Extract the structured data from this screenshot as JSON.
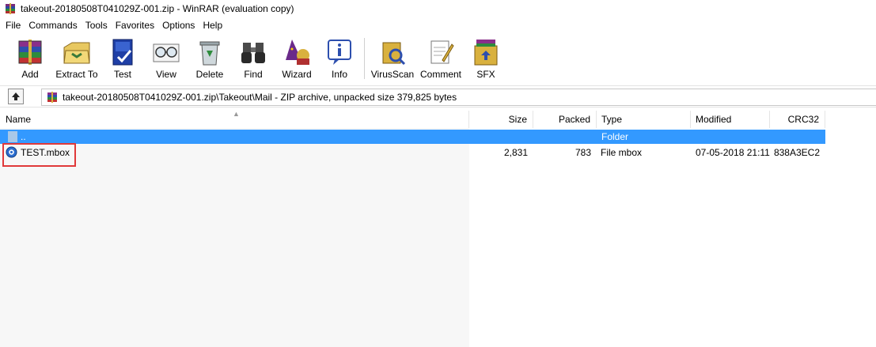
{
  "window": {
    "title": "takeout-20180508T041029Z-001.zip - WinRAR (evaluation copy)"
  },
  "menu": [
    "File",
    "Commands",
    "Tools",
    "Favorites",
    "Options",
    "Help"
  ],
  "toolbar": {
    "add": "Add",
    "extract_to": "Extract To",
    "test": "Test",
    "view": "View",
    "delete": "Delete",
    "find": "Find",
    "wizard": "Wizard",
    "info": "Info",
    "virusscan": "VirusScan",
    "comment": "Comment",
    "sfx": "SFX"
  },
  "address": {
    "path": "takeout-20180508T041029Z-001.zip\\Takeout\\Mail - ZIP archive, unpacked size 379,825 bytes"
  },
  "columns": {
    "name": "Name",
    "size": "Size",
    "packed": "Packed",
    "type": "Type",
    "modified": "Modified",
    "crc32": "CRC32"
  },
  "rows": [
    {
      "name": "..",
      "size": "",
      "packed": "",
      "type": "Folder",
      "modified": "",
      "crc32": ""
    },
    {
      "name": "TEST.mbox",
      "size": "2,831",
      "packed": "783",
      "type": "File mbox",
      "modified": "07-05-2018 21:11",
      "crc32": "838A3EC2"
    }
  ],
  "colors": {
    "selection": "#3399ff",
    "highlight_box": "#e0393a"
  }
}
